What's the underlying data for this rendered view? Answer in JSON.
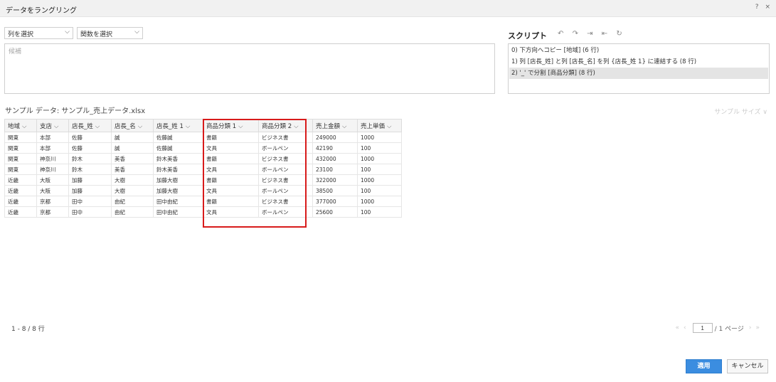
{
  "window": {
    "title": "データをラングリング",
    "help": "?",
    "close": "×"
  },
  "selectors": {
    "column": "列を選択",
    "function": "関数を選択"
  },
  "candidates": {
    "placeholder": "候補"
  },
  "script": {
    "title": "スクリプト",
    "tools": [
      "↶",
      "↷",
      "⇥",
      "⇤",
      "↻"
    ],
    "steps": [
      {
        "text": "0) 下方向へコピー [地域] (6 行)",
        "selected": false
      },
      {
        "text": "1) 列 [店長_姓] と列 [店長_名] を列 {店長_姓 1} に連結する (8 行)",
        "selected": false
      },
      {
        "text": "2) '_' で分割 [商品分類] (8 行)",
        "selected": true
      }
    ]
  },
  "sample": {
    "label": "サンプル データ: サンプル_売上データ.xlsx",
    "size_label": "サンプル サイズ ∨"
  },
  "table": {
    "columns": [
      "地域",
      "支店",
      "店長_姓",
      "店長_名",
      "店長_姓 1",
      "商品分類 1",
      "商品分類 2",
      "売上金額",
      "売上単価"
    ],
    "rows": [
      [
        "関東",
        "本部",
        "佐藤",
        "誠",
        "佐藤誠",
        "書籍",
        "ビジネス書",
        "249000",
        "1000"
      ],
      [
        "関東",
        "本部",
        "佐藤",
        "誠",
        "佐藤誠",
        "文具",
        "ボールペン",
        "42190",
        "100"
      ],
      [
        "関東",
        "神奈川",
        "鈴木",
        "美香",
        "鈴木美香",
        "書籍",
        "ビジネス書",
        "432000",
        "1000"
      ],
      [
        "関東",
        "神奈川",
        "鈴木",
        "美香",
        "鈴木美香",
        "文具",
        "ボールペン",
        "23100",
        "100"
      ],
      [
        "近畿",
        "大阪",
        "加藤",
        "大樹",
        "加藤大樹",
        "書籍",
        "ビジネス書",
        "322000",
        "1000"
      ],
      [
        "近畿",
        "大阪",
        "加藤",
        "大樹",
        "加藤大樹",
        "文具",
        "ボールペン",
        "38500",
        "100"
      ],
      [
        "近畿",
        "京都",
        "田中",
        "由紀",
        "田中由紀",
        "書籍",
        "ビジネス書",
        "377000",
        "1000"
      ],
      [
        "近畿",
        "京都",
        "田中",
        "由紀",
        "田中由紀",
        "文具",
        "ボールペン",
        "25600",
        "100"
      ]
    ]
  },
  "footer": {
    "row_count": "1 - 8 / 8 行",
    "pager": {
      "first": "«",
      "prev": "‹",
      "page": "1",
      "total": "/ 1  ページ",
      "next": "›",
      "last": "»"
    }
  },
  "buttons": {
    "apply": "適用",
    "cancel": "キャンセル"
  },
  "colors": {
    "accent": "#3b8de0",
    "highlight": "#d81b1b"
  }
}
